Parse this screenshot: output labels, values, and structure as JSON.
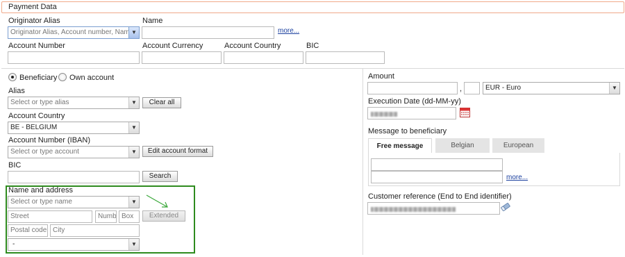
{
  "section": {
    "title": "Payment Data"
  },
  "originator": {
    "alias_label": "Originator Alias",
    "alias_placeholder": "Originator Alias, Account number, Name",
    "name_label": "Name",
    "more_link": "more...",
    "account_number_label": "Account Number",
    "account_currency_label": "Account Currency",
    "account_country_label": "Account Country",
    "bic_label": "BIC"
  },
  "beneficiary": {
    "radio_beneficiary": "Beneficiary",
    "radio_own_account": "Own account",
    "selected_radio": "Beneficiary",
    "alias_label": "Alias",
    "alias_placeholder": "Select or type alias",
    "clear_all_button": "Clear all",
    "country_label": "Account Country",
    "country_value": "BE - BELGIUM",
    "account_number_label": "Account Number (IBAN)",
    "account_placeholder": "Select or type account",
    "edit_format_button": "Edit account format",
    "bic_label": "BIC",
    "search_button": "Search",
    "name_address_label": "Name and address",
    "name_placeholder": "Select or type name",
    "street_placeholder": "Street",
    "number_placeholder": "Numb",
    "box_placeholder": "Box",
    "extended_button": "Extended",
    "postal_code_placeholder": "Postal code",
    "city_placeholder": "City",
    "country_select_value": "-"
  },
  "amount": {
    "label": "Amount",
    "decimal_separator": ",",
    "currency_value": "EUR - Euro",
    "execution_date_label": "Execution Date (dd-MM-yy)",
    "message_label": "Message to beneficiary",
    "tabs": [
      "Free message",
      "Belgian",
      "European"
    ],
    "active_tab": "Free message",
    "more_link": "more...",
    "customer_reference_label": "Customer reference (End to End identifier)"
  },
  "colors": {
    "header_border": "#f0a989",
    "highlight_box": "#2e8b1e",
    "arrow": "#3aa83a",
    "link": "#1a3f9e"
  },
  "icons": {
    "calendar": "calendar-icon",
    "eraser": "eraser-icon"
  }
}
